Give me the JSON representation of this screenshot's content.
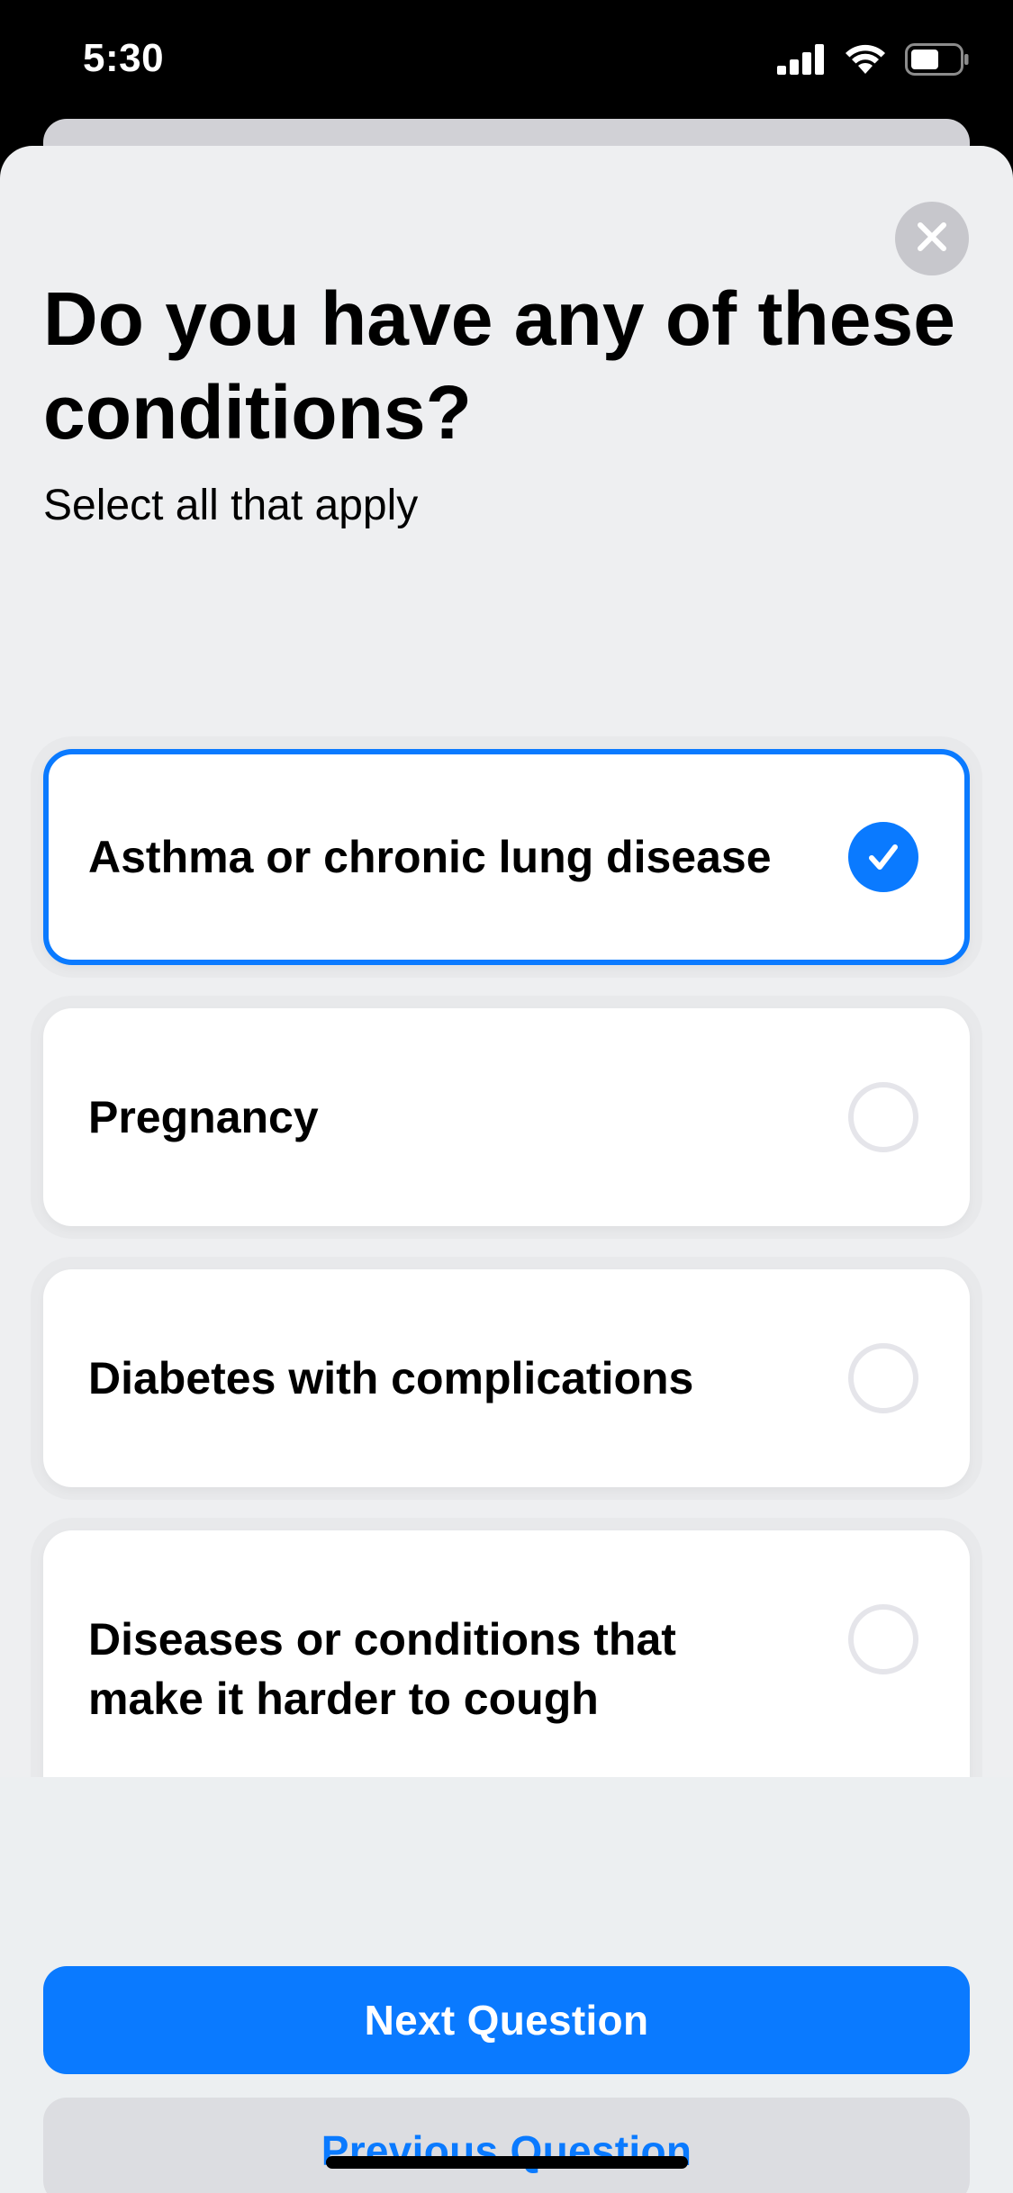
{
  "status_bar": {
    "time": "5:30",
    "icons": [
      "cellular-signal-icon",
      "wifi-icon",
      "battery-icon"
    ]
  },
  "question": {
    "title": "Do you have any of these conditions?",
    "subtitle": "Select all that apply"
  },
  "options": [
    {
      "label": "Asthma or chronic lung disease",
      "selected": true
    },
    {
      "label": "Pregnancy",
      "selected": false
    },
    {
      "label": "Diabetes with complications",
      "selected": false
    },
    {
      "label": "Diseases or conditions that make it harder to cough",
      "selected": false
    }
  ],
  "buttons": {
    "next": "Next Question",
    "previous": "Previous Question"
  },
  "colors": {
    "accent": "#0a7aff",
    "sheet_background": "#eeeff1",
    "card_background": "#ffffff",
    "secondary_button": "#dcdde1"
  }
}
